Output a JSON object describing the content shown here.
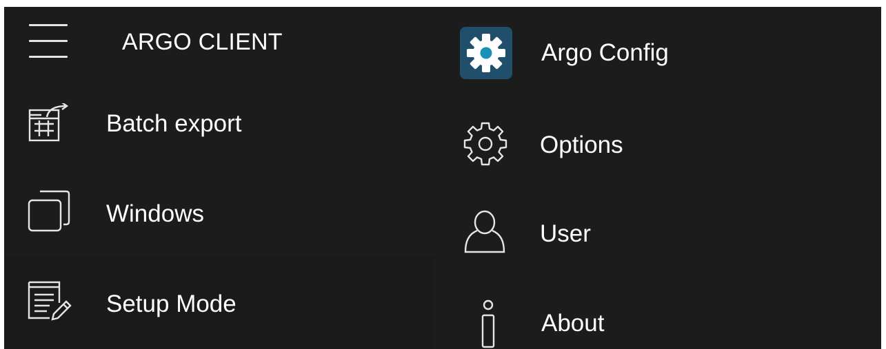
{
  "header": {
    "title": "ARGO CLIENT"
  },
  "left_menu": {
    "items": [
      {
        "label": "Batch export",
        "icon": "batch-export-icon"
      },
      {
        "label": "Windows",
        "icon": "windows-icon"
      },
      {
        "label": "Setup Mode",
        "icon": "setup-mode-icon"
      }
    ]
  },
  "right_menu": {
    "items": [
      {
        "label": "Argo Config",
        "icon": "gear-app-icon"
      },
      {
        "label": "Options",
        "icon": "gear-icon"
      },
      {
        "label": "User",
        "icon": "user-icon"
      },
      {
        "label": "About",
        "icon": "info-icon"
      }
    ]
  },
  "colors": {
    "background": "#1c1c1c",
    "text": "#ffffff",
    "app_tile": "#1f4f6b",
    "accent": "#1a8fb8"
  }
}
